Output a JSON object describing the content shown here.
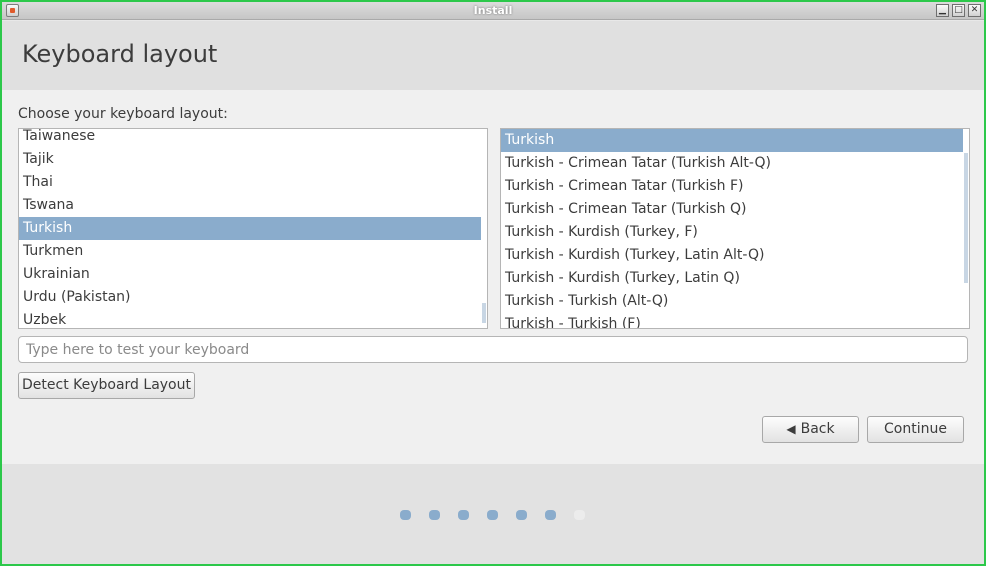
{
  "window": {
    "title": "Install",
    "controls": {
      "minimize": "▁",
      "maximize": "□",
      "close": "✕"
    }
  },
  "header": {
    "title": "Keyboard layout"
  },
  "prompt": "Choose your keyboard layout:",
  "layout_list": {
    "selected": "Turkish",
    "items": [
      "Taiwanese",
      "Tajik",
      "Thai",
      "Tswana",
      "Turkish",
      "Turkmen",
      "Ukrainian",
      "Urdu (Pakistan)",
      "Uzbek"
    ]
  },
  "variant_list": {
    "selected": "Turkish",
    "items": [
      "Turkish",
      "Turkish - Crimean Tatar (Turkish Alt-Q)",
      "Turkish - Crimean Tatar (Turkish F)",
      "Turkish - Crimean Tatar (Turkish Q)",
      "Turkish - Kurdish (Turkey, F)",
      "Turkish - Kurdish (Turkey, Latin Alt-Q)",
      "Turkish - Kurdish (Turkey, Latin Q)",
      "Turkish - Turkish (Alt-Q)",
      "Turkish - Turkish (F)"
    ]
  },
  "test_input": {
    "placeholder": "Type here to test your keyboard",
    "value": ""
  },
  "buttons": {
    "detect": "Detect Keyboard Layout",
    "back": "Back",
    "continue": "Continue"
  },
  "icons": {
    "back": "chevron-left-icon"
  },
  "progress": {
    "total_steps": 7,
    "completed_steps": 6
  },
  "colors": {
    "selection": "#8aaccc",
    "window_border": "#2cc84a"
  }
}
